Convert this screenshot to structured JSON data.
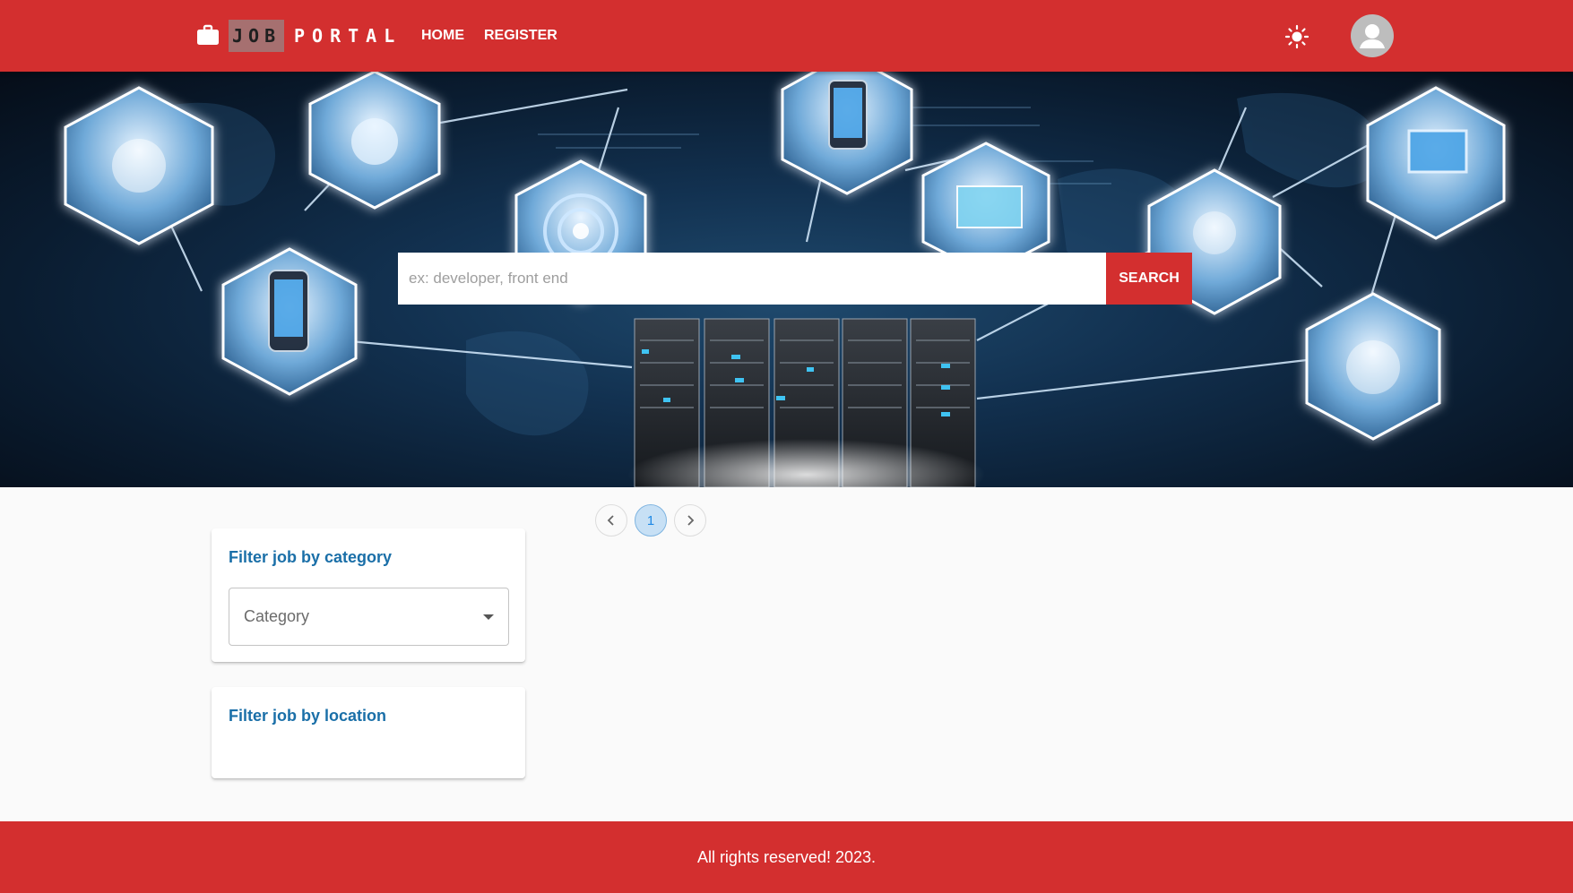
{
  "header": {
    "brand_part1": "JOB",
    "brand_part2": "PORTAL",
    "nav": [
      {
        "label": "HOME"
      },
      {
        "label": "REGISTER"
      }
    ],
    "theme_toggle_icon": "sun-icon",
    "avatar_icon": "user-avatar-icon"
  },
  "hero": {
    "search": {
      "value": "",
      "placeholder": "ex: developer, front end",
      "button_label": "SEARCH"
    }
  },
  "pagination": {
    "current_page": "1",
    "prev_icon": "chevron-left-icon",
    "next_icon": "chevron-right-icon"
  },
  "filters": {
    "category": {
      "title": "Filter job by category",
      "placeholder": "Category"
    },
    "location": {
      "title": "Filter job by location"
    }
  },
  "footer": {
    "text": "All rights reserved! 2023."
  },
  "colors": {
    "primary": "#d32f2f",
    "filter_title": "#1a6fa8",
    "page_active": "#c7e0f5"
  }
}
